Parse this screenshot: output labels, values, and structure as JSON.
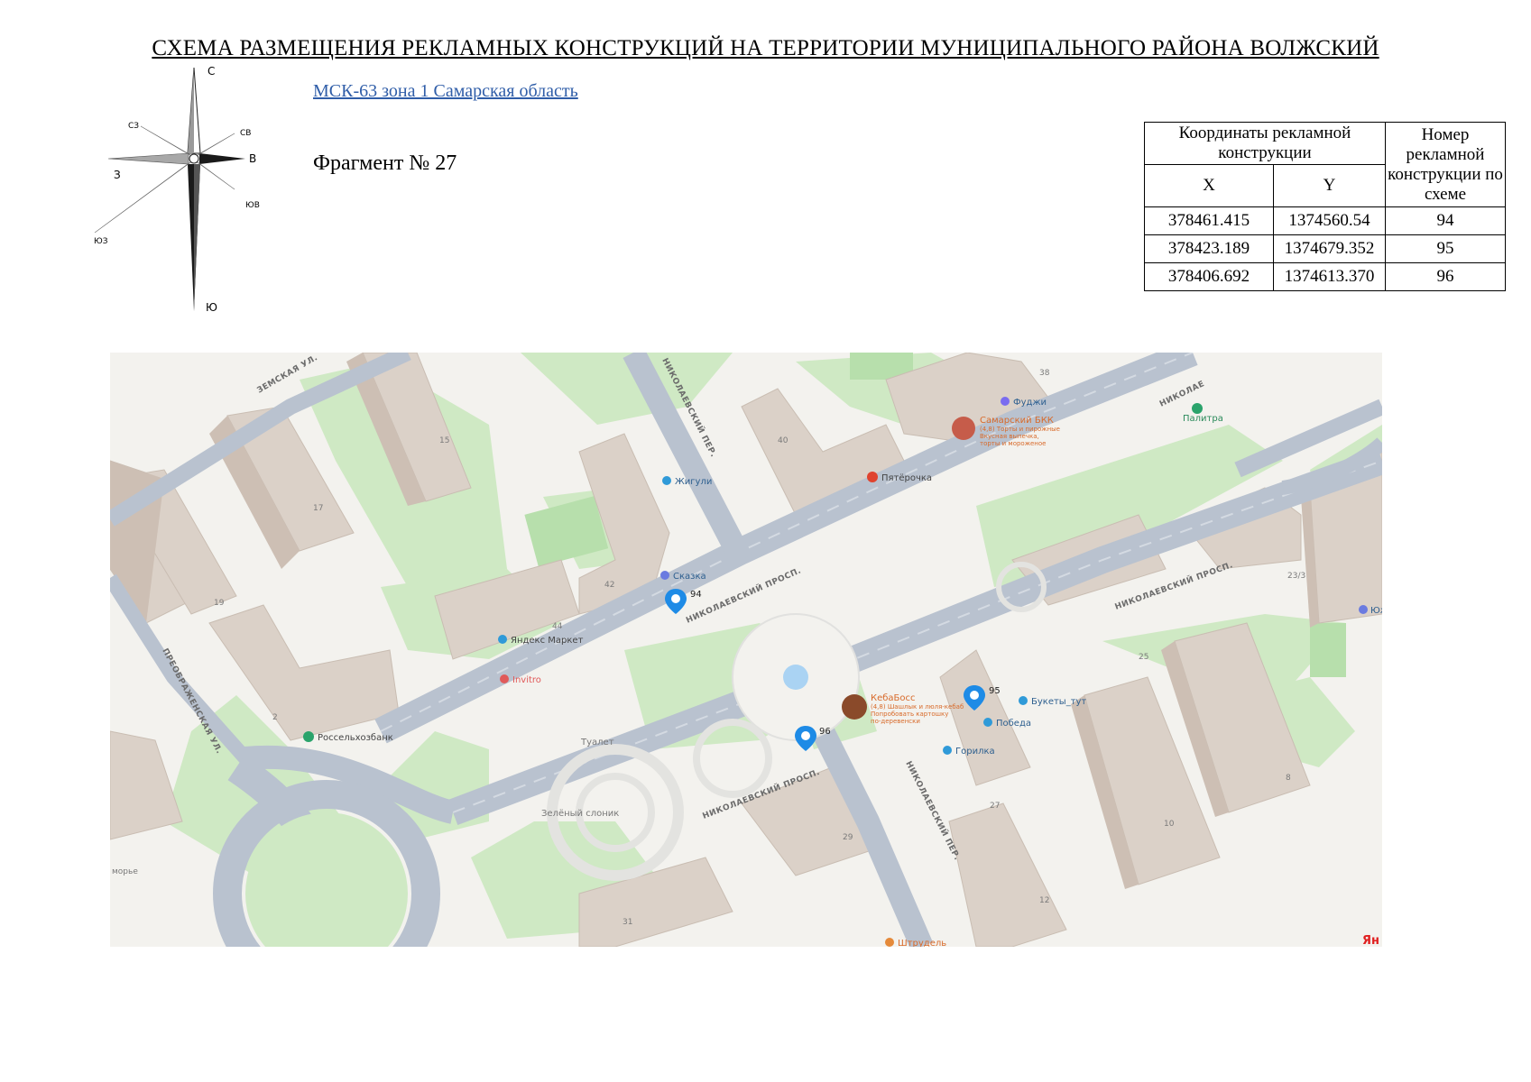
{
  "title": "СХЕМА РАЗМЕЩЕНИЯ РЕКЛАМНЫХ КОНСТРУКЦИЙ НА ТЕРРИТОРИИ МУНИЦИПАЛЬНОГО РАЙОНА ВОЛЖСКИЙ",
  "crs": "МСК-63 зона 1 Самарская область",
  "fragment": "Фрагмент № 27",
  "compass": {
    "n": "С",
    "s": "Ю",
    "w": "З",
    "e": "В",
    "nw": "СЗ",
    "ne": "СВ",
    "sw": "ЮЗ",
    "se": "ЮВ"
  },
  "table": {
    "header_coords": "Координаты рекламной конструкции",
    "header_num": "Номер рекламной конструкции по схеме",
    "col_x": "X",
    "col_y": "Y",
    "rows": [
      {
        "x": "378461.415",
        "y": "1374560.54",
        "num": "94"
      },
      {
        "x": "378423.189",
        "y": "1374679.352",
        "num": "95"
      },
      {
        "x": "378406.692",
        "y": "1374613.370",
        "num": "96"
      }
    ]
  },
  "map": {
    "streets": {
      "zemskaya": "ЗЕМСКАЯ УЛ.",
      "nikolaevsky_per_top": "НИКОЛАЕВСКИЙ ПЕР.",
      "nikolaevsky_per_bottom": "НИКОЛАЕВСКИЙ ПЕР.",
      "nikolaevsky_pr_1": "НИКОЛАЕВСКИЙ ПРОСП.",
      "nikolaevsky_pr_2": "НИКОЛАЕВСКИЙ ПРОСП.",
      "nikolaevsky_pr_3": "НИКОЛАЕВСКИЙ ПРОСП.",
      "nikolaevsky_top_right": "НИКОЛАЕ",
      "preobrazhenskaya": "ПРЕОБРАЖЕНСКАЯ УЛ."
    },
    "buildings": {
      "b15": "15",
      "b17": "17",
      "b19": "19",
      "b2": "2",
      "b42": "42",
      "b44": "44",
      "b40": "40",
      "b38": "38",
      "b23": "23/3",
      "b25": "25",
      "b8": "8",
      "b10": "10",
      "b27": "27",
      "b29": "29",
      "b31": "31",
      "b12": "12"
    },
    "pois": {
      "fuji": "Фуджи",
      "samarsky": "Самарский БКК",
      "samarsky_sub1": "(4,8) Торты и пирожные",
      "samarsky_sub2": "Вкусная выпечка,",
      "samarsky_sub3": "торты и мороженое",
      "palitra": "Палитра",
      "zhiguli": "Жигули",
      "pyaterochka": "Пятёрочка",
      "skazka": "Сказка",
      "yandex_market": "Яндекс Маркет",
      "invitro": "Invitro",
      "rosselhozbank": "Россельхозбанк",
      "tualet": "Туалет",
      "zeleny_slonik": "Зелёный слоник",
      "kebaboss": "КебаБосс",
      "kebaboss_sub1": "(4,8) Шашлык и люля-кебаб",
      "kebaboss_sub2": "Попробовать картошку",
      "kebaboss_sub3": "по-деревенски",
      "bukety": "Букеты_тут",
      "pobeda": "Победа",
      "gorilka": "Горилка",
      "shtrudel": "Штрудель",
      "yuzh": "Юж",
      "morye": "морье",
      "yandex_logo": "Ян"
    },
    "markers": [
      "94",
      "95",
      "96"
    ],
    "colors": {
      "marker": "#1e8be6",
      "road": "#b9c2cf",
      "building": "#d9cfc7",
      "park": "#cfe9c4",
      "background": "#f3f2ee"
    }
  }
}
